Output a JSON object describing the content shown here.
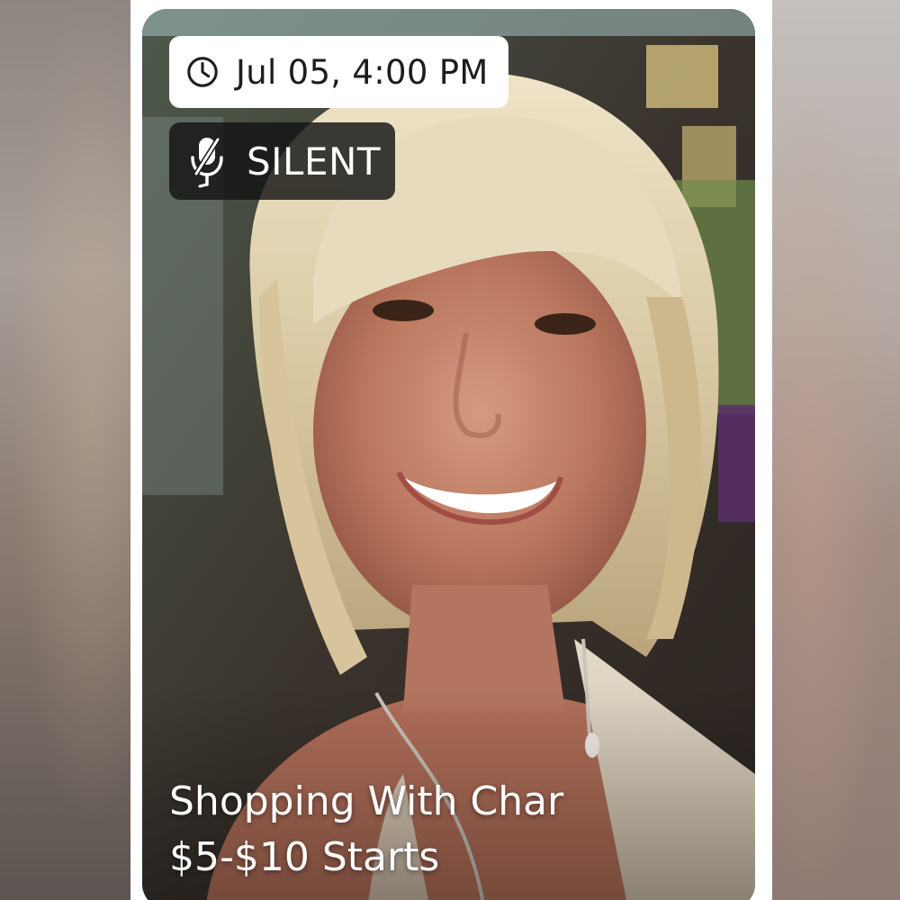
{
  "card": {
    "schedule": "Jul 05, 4:00 PM",
    "auction_type": "SILENT",
    "title": "Shopping With Char",
    "subtitle": "$5-$10 Starts"
  },
  "icons": {
    "schedule": "clock-icon",
    "auction_type": "muted-microphone-icon"
  },
  "colors": {
    "badge_light": "#ffffff",
    "badge_dark": "#1a1a1a",
    "caption_text": "#ffffff"
  }
}
